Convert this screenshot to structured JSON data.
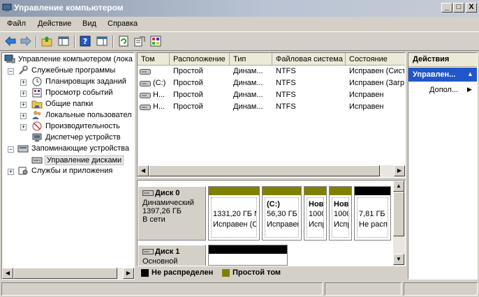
{
  "window": {
    "title": "Управление компьютером",
    "minimize_glyph": "_",
    "maximize_glyph": "□",
    "close_glyph": "X"
  },
  "menu": [
    "Файл",
    "Действие",
    "Вид",
    "Справка"
  ],
  "tree": {
    "root": "Управление компьютером (лока",
    "system_tools": "Служебные программы",
    "task_scheduler": "Планировщик заданий",
    "event_viewer": "Просмотр событий",
    "shared_folders": "Общие папки",
    "local_users": "Локальные пользовател",
    "performance": "Производительность",
    "device_manager": "Диспетчер устройств",
    "storage": "Запоминающие устройства",
    "disk_management": "Управление дисками",
    "services": "Службы и приложения",
    "expand_glyph": "+",
    "collapse_glyph": "−"
  },
  "volumes": {
    "columns": [
      "Том",
      "Расположение",
      "Тип",
      "Файловая система",
      "Состояние"
    ],
    "rows": [
      {
        "name": "",
        "layout": "Простой",
        "type": "Динам...",
        "fs": "NTFS",
        "status": "Исправен (Сист"
      },
      {
        "name": "(C:)",
        "layout": "Простой",
        "type": "Динам...",
        "fs": "NTFS",
        "status": "Исправен (Загр"
      },
      {
        "name": "Н...",
        "layout": "Простой",
        "type": "Динам...",
        "fs": "NTFS",
        "status": "Исправен"
      },
      {
        "name": "Н...",
        "layout": "Простой",
        "type": "Динам...",
        "fs": "NTFS",
        "status": "Исправен"
      }
    ]
  },
  "disks": {
    "disk0": {
      "name": "Диск 0",
      "type": "Динамический",
      "size": "1397,26 ГБ",
      "state": "В сети",
      "partitions": [
        {
          "title": "",
          "size": "1331,20 ГБ N",
          "status": "Исправен (С",
          "color": "#808000"
        },
        {
          "title": "(C:)",
          "size": "56,30 ГБ",
          "status": "Исправен",
          "color": "#808000"
        },
        {
          "title": "Нов",
          "size": "1000",
          "status": "Испр",
          "color": "#808000"
        },
        {
          "title": "Нов",
          "size": "1000",
          "status": "Испр",
          "color": "#808000"
        },
        {
          "title": "",
          "size": "7,81 ГБ",
          "status": "Не расп",
          "color": "#000000"
        }
      ]
    },
    "disk1": {
      "name": "Диск 1",
      "type": "Основной",
      "partition_color": "#000000"
    }
  },
  "legend": [
    {
      "label": "Не распределен",
      "color": "#000000"
    },
    {
      "label": "Простой том",
      "color": "#808000"
    }
  ],
  "actions": {
    "header": "Действия",
    "section": "Управлен...",
    "more": "Допол..."
  },
  "colors": {
    "accent": "#2257c9",
    "simple_volume": "#808000",
    "unallocated": "#000000"
  }
}
